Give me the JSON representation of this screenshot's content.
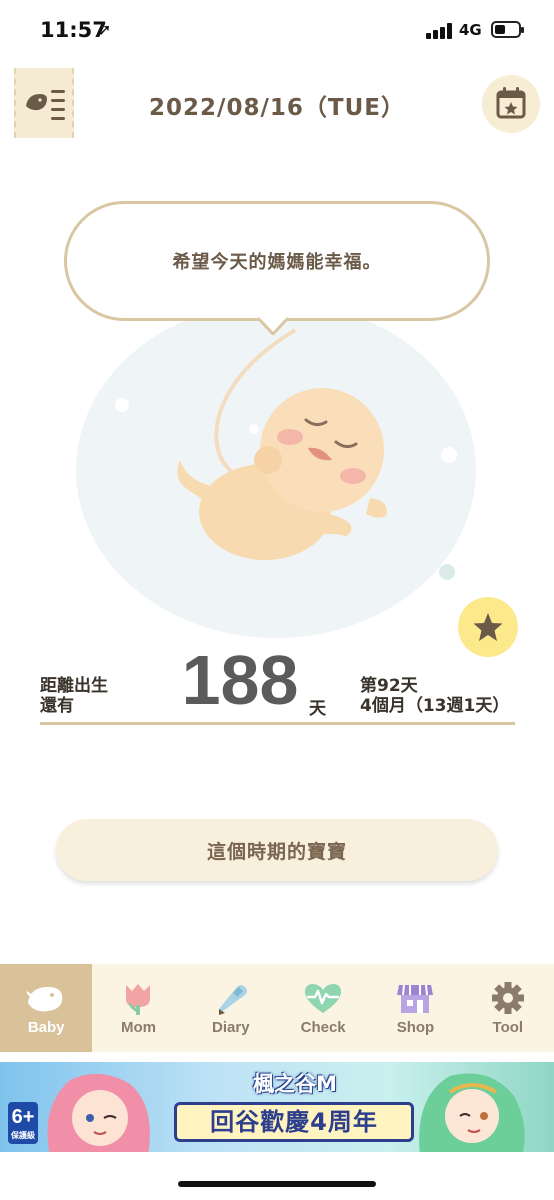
{
  "status_bar": {
    "time": "11:57",
    "network": "4G",
    "battery_level": 0.45
  },
  "header": {
    "date": "2022/08/16（TUE）"
  },
  "bubble": {
    "message": "希望今天的媽媽能幸福。"
  },
  "countdown": {
    "label_line1": "距離出生",
    "label_line2": "還有",
    "days_left": "188",
    "unit": "天",
    "day_count": "第92天",
    "month_week": "4個月（13週1天）"
  },
  "period_button": {
    "label": "這個時期的寶寶"
  },
  "tabs": [
    {
      "label": "Baby",
      "icon": "bird-icon",
      "active": true
    },
    {
      "label": "Mom",
      "icon": "tulip-icon",
      "active": false
    },
    {
      "label": "Diary",
      "icon": "pencil-icon",
      "active": false
    },
    {
      "label": "Check",
      "icon": "heart-pulse-icon",
      "active": false
    },
    {
      "label": "Shop",
      "icon": "store-icon",
      "active": false
    },
    {
      "label": "Tool",
      "icon": "gear-icon",
      "active": false
    }
  ],
  "ad": {
    "rating": "6+",
    "rating_note": "保護級",
    "brand": "楓之谷M",
    "slogan": "回谷歡慶4周年"
  },
  "colors": {
    "accent": "#d9c29a",
    "text": "#6b5a48",
    "tab_bg": "#fbf4e2",
    "star_bg": "#fbe98c"
  }
}
